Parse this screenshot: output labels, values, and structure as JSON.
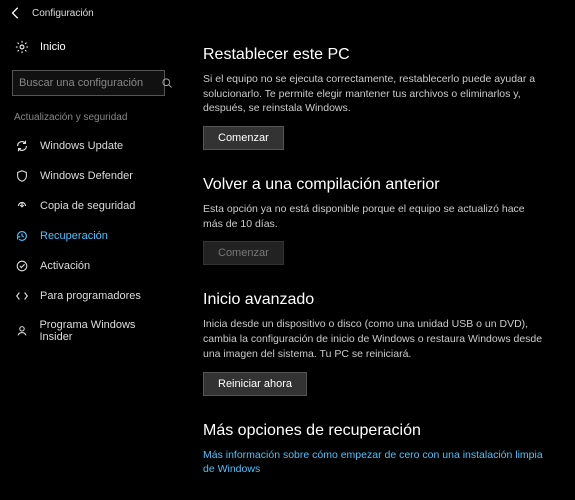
{
  "titlebar": {
    "title": "Configuración"
  },
  "sidebar": {
    "home": "Inicio",
    "search_placeholder": "Buscar una configuración",
    "group": "Actualización y seguridad",
    "items": [
      {
        "label": "Windows Update"
      },
      {
        "label": "Windows Defender"
      },
      {
        "label": "Copia de seguridad"
      },
      {
        "label": "Recuperación"
      },
      {
        "label": "Activación"
      },
      {
        "label": "Para programadores"
      },
      {
        "label": "Programa Windows Insider"
      }
    ]
  },
  "content": {
    "reset": {
      "title": "Restablecer este PC",
      "desc": "Si el equipo no se ejecuta correctamente, restablecerlo puede ayudar a solucionarlo. Te permite elegir mantener tus archivos o eliminarlos y, después, se reinstala Windows.",
      "button": "Comenzar"
    },
    "rollback": {
      "title": "Volver a una compilación anterior",
      "desc": "Esta opción ya no está disponible porque el equipo se actualizó hace más de 10 días.",
      "button": "Comenzar"
    },
    "advanced": {
      "title": "Inicio avanzado",
      "desc": "Inicia desde un dispositivo o disco (como una unidad USB o un DVD), cambia la configuración de inicio de Windows o restaura Windows desde una imagen del sistema. Tu PC se reiniciará.",
      "button": "Reiniciar ahora"
    },
    "more": {
      "title": "Más opciones de recuperación",
      "link": "Más información sobre cómo empezar de cero con una instalación limpia de Windows"
    }
  }
}
